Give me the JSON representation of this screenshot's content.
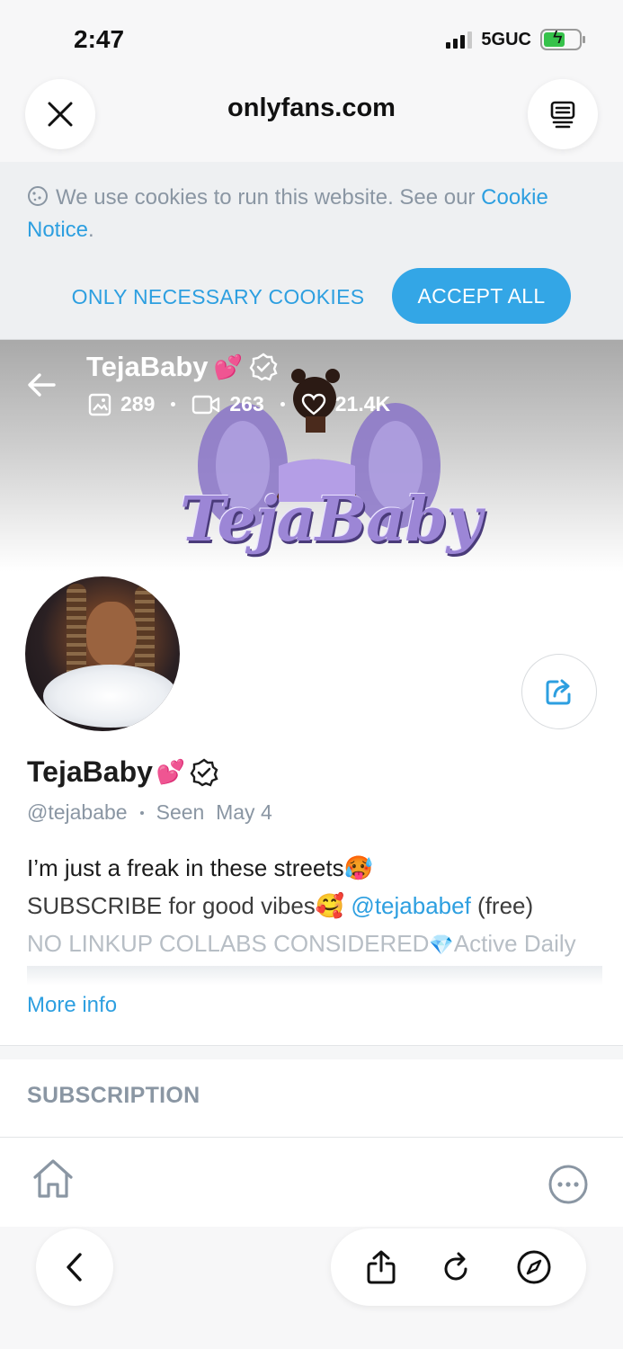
{
  "status_bar": {
    "time": "2:47",
    "network": "5GUC"
  },
  "browser": {
    "url": "onlyfans.com"
  },
  "cookie_banner": {
    "text": "We use cookies to run this website. See our",
    "link_text": "Cookie Notice",
    "after_link": ".",
    "necessary_label": "ONLY NECESSARY COOKIES",
    "accept_label": "ACCEPT ALL"
  },
  "cover": {
    "name": "TejaBaby",
    "name_emoji": "💕",
    "photos_count": "289",
    "videos_count": "263",
    "likes_count": "21.4K",
    "logo_text": "TejaBaby"
  },
  "profile": {
    "name": "TejaBaby",
    "name_emoji": "💕",
    "handle": "@tejababe",
    "seen": "Seen  May 4",
    "bio_line1": "I’m just a freak in these streets",
    "bio_line1_emoji": "🥵",
    "bio_line2_pre": "SUBSCRIBE for good vibes",
    "bio_line2_emoji": "🥰",
    "bio_mention": "@tejababef",
    "bio_line2_post": " (free)",
    "bio_line3": "NO LINKUP COLLABS CONSIDERED",
    "bio_line3_emoji": "💎",
    "bio_line3_post": "Active Daily",
    "more_info": "More info"
  },
  "sections": {
    "subscription": "SUBSCRIPTION"
  },
  "icons": {
    "close": "close-icon",
    "tabs": "tabs-icon",
    "cookie": "cookie-icon",
    "back": "arrow-left-icon",
    "photo": "image-icon",
    "video": "video-icon",
    "heart": "heart-icon",
    "verified": "verified-badge-icon",
    "share": "share-icon",
    "home": "home-icon",
    "more": "more-icon",
    "browser_back": "chevron-left-icon",
    "browser_share": "share-upload-icon",
    "reload": "reload-icon",
    "compass": "compass-icon"
  },
  "colors": {
    "accent": "#33a6e6",
    "muted": "#8a96a3",
    "link": "#2d9fe0"
  }
}
